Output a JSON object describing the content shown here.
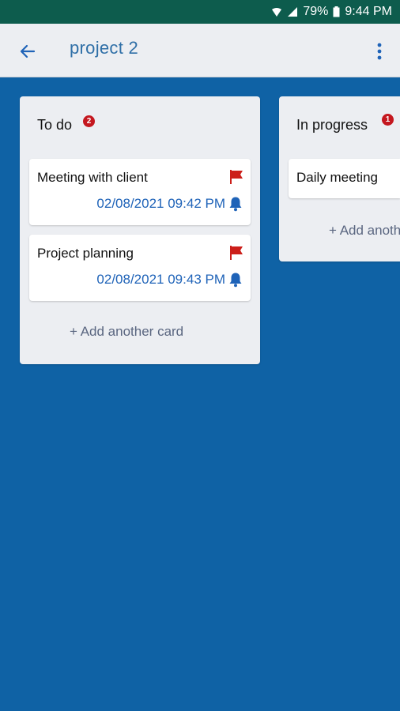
{
  "status_bar": {
    "battery": "79%",
    "time": "9:44 PM"
  },
  "app_bar": {
    "title": "project 2",
    "icons": [
      "back-arrow-icon",
      "more-vert-icon"
    ]
  },
  "colors": {
    "status_bar": "#0d5c4d",
    "board_background": "#0f62a5",
    "list_background": "#eceef2",
    "badge": "#c4171f",
    "flag": "#cc1f1a",
    "date_text": "#1f63b8"
  },
  "lists": [
    {
      "title": "To do",
      "badge": "2",
      "cards": [
        {
          "title": "Meeting with client",
          "date": "02/08/2021 09:42 PM",
          "flag_icon": "flag-icon",
          "reminder_icon": "bell-icon"
        },
        {
          "title": "Project planning",
          "date": "02/08/2021 09:43 PM",
          "flag_icon": "flag-icon",
          "reminder_icon": "bell-icon"
        }
      ],
      "add_label": "+ Add another card"
    },
    {
      "title": "In progress",
      "badge": "1",
      "cards": [
        {
          "title": "Daily meeting"
        }
      ],
      "add_label": "+ Add another card"
    }
  ]
}
